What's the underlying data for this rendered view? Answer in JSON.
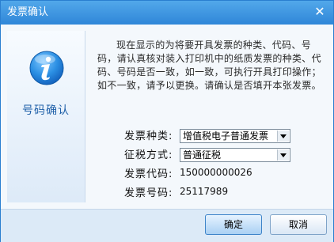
{
  "window": {
    "title": "发票确认",
    "close_glyph": "✕"
  },
  "left_panel": {
    "icon": "info-icon",
    "label": "号码确认"
  },
  "message": "现在显示的为将要开具发票的种类、代码、号码，请认真核对装入打印机中的纸质发票的种类、代码、号码是否一致，如一致，可执行开具打印操作；如不一致，请予以更换。请确认是否填开本张发票。",
  "form": {
    "invoice_type": {
      "label": "发票种类:",
      "value": "增值税电子普通发票"
    },
    "tax_method": {
      "label": "征税方式:",
      "value": "普通征税"
    },
    "invoice_code": {
      "label": "发票代码:",
      "value": "150000000026"
    },
    "invoice_number": {
      "label": "发票号码:",
      "value": "25117989"
    }
  },
  "buttons": {
    "confirm": "确定",
    "cancel": "取消"
  },
  "colors": {
    "titlebar": "#2f86d8",
    "accent": "#1e5fa8"
  }
}
